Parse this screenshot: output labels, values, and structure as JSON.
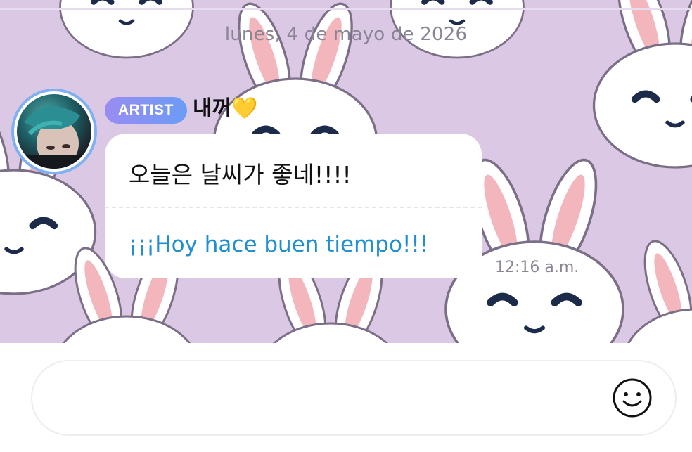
{
  "chat": {
    "date": "lunes, 4 de mayo de 2026"
  },
  "message": {
    "badge": "ARTIST",
    "sender": "내꺼",
    "sender_emoji": "💛",
    "original_text": "오늘은 날씨가 좋네!!!!",
    "translated_text": "¡¡¡Hoy hace buen tiempo!!!",
    "time": "12:16 a.m."
  },
  "composer": {
    "emoji_icon": "smiley-icon"
  },
  "colors": {
    "wallpaper": "#dac8e4",
    "badge_start": "#9a8cf2",
    "badge_end": "#6b9cf5",
    "translation": "#1f8fd0",
    "avatar_ring": "#7fb0f2"
  }
}
